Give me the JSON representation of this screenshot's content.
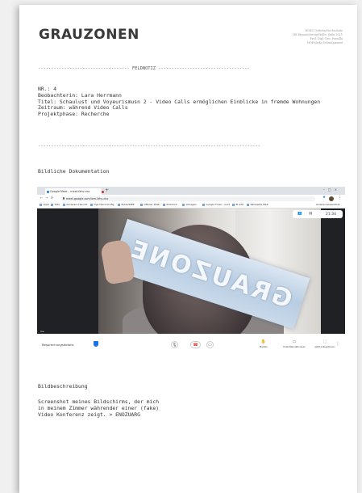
{
  "header": {
    "brand": "GRAUZONEN",
    "institution_lines": [
      "HGKU Ostfalia/Hochschule",
      "Hil Braunschweig/Wolfe. Sufis 2021",
      "Prof. Dipl.-Des. Pernilla",
      "HOF.Mode/Urbanfamarnt"
    ]
  },
  "feldnotiz": {
    "separator": "----------------------------------- FELDNOTIZ -----------------------------------",
    "nr": "NR.: 4",
    "beobachterin": "Beobachterin: Lara Herrmann",
    "titel": "Titel: Schaulust und Voyeurismusn 2 - Video Calls ermöglichen Einblicke in fremde Wohnungen",
    "zeitraum": "Zeitraum: während Video Calls",
    "projektphase": "Projektphase: Recherche",
    "end_separator": "-------------------------------------------------------------------------------------"
  },
  "dokumentation_label": "Bildliche Dokumentation",
  "screenshot": {
    "browser_tab": "Google Meet – meet-fzhv-cbc",
    "url": "meet.google.com/ixm-fzhv-cbc",
    "bookmarks": [
      "Apps",
      "Tolls",
      "Kurzwarе Hard Pl.",
      "Dgz Hand Konfig",
      "PULLVIDEE",
      "Offener Rhet.",
      "Protokoll",
      "Vorlagen",
      "Google Fmen - pol3",
      "Bl 225",
      "Wikipedia Web"
    ],
    "bookmarks_right": "Andere Lesezeichen",
    "sign_text": "GRAUZONE",
    "clock": "21:34",
    "self_tile_label": "Sie",
    "meeting_details": "Besprechungsdetails",
    "actions": [
      {
        "glyph": "✋",
        "label": "Melden"
      },
      {
        "glyph": "▭",
        "label": "Untertitel aktivieren"
      },
      {
        "glyph": "⬚",
        "label": "Jetzt präsentieren"
      }
    ]
  },
  "bildbeschreibung": {
    "label": "Bildbeschreibung",
    "text": "Screenshot meines Bildschirms, der mich\nin meinem Zimmer währender einer (fake)\nVideo Konferenz zeigt. > ENOZUARG"
  },
  "colors": {
    "meet_blue": "#1a73e8",
    "hangup_red": "#d93025",
    "page_bg": "#f0f0f0"
  }
}
